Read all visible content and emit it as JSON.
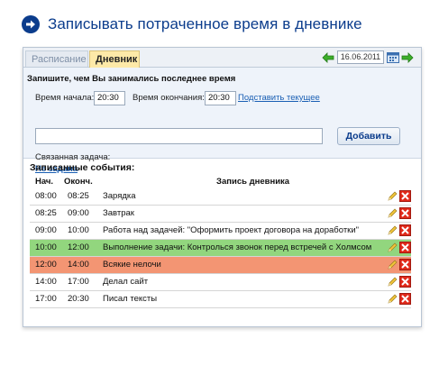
{
  "header": {
    "title": "Записывать потраченное время в дневнике",
    "icon": "arrow-right-icon"
  },
  "tabs": {
    "schedule": "Расписание",
    "diary": "Дневник"
  },
  "date_nav": {
    "date": "16.06.2011",
    "prev_icon": "arrow-left-icon",
    "next_icon": "arrow-right-icon",
    "calendar_icon": "calendar-icon"
  },
  "form": {
    "prompt": "Запишите, чем Вы занимались последнее время",
    "start_label": "Время начала:",
    "start_value": "20:30",
    "end_label": "Время окончания:",
    "end_value": "20:30",
    "now_link": "Подставить текущее",
    "entry_value": "",
    "add_button": "Добавить",
    "related_label": "Связанная задача:",
    "related_link": "Не задана"
  },
  "events": {
    "title": "Записанные события:",
    "columns": {
      "start": "Нач.",
      "end": "Оконч.",
      "entry": "Запись дневника"
    },
    "rows": [
      {
        "start": "08:00",
        "end": "08:25",
        "text": "Зарядка",
        "color": "#ffffff"
      },
      {
        "start": "08:25",
        "end": "09:00",
        "text": "Завтрак",
        "color": "#ffffff"
      },
      {
        "start": "09:00",
        "end": "10:00",
        "text": "Работа над задачей: \"Оформить проект договора на доработки\"",
        "color": "#ffffff"
      },
      {
        "start": "10:00",
        "end": "12:00",
        "text": "Выполнение задачи: Контролься звонок перед встречей с Холмсом",
        "color": "#92d67e"
      },
      {
        "start": "12:00",
        "end": "14:00",
        "text": "Всякие нелочи",
        "color": "#f39573"
      },
      {
        "start": "14:00",
        "end": "17:00",
        "text": "Делал сайт",
        "color": "#ffffff"
      },
      {
        "start": "17:00",
        "end": "20:30",
        "text": "Писал тексты",
        "color": "#ffffff"
      }
    ],
    "row_actions": {
      "edit_icon": "pencil-icon",
      "delete_icon": "delete-icon"
    }
  },
  "colors": {
    "accent": "#0b3c8c",
    "link": "#1a5fb4",
    "active_tab": "#fde9a8",
    "nav_green": "#3cae2a",
    "delete": "#e02a1b"
  }
}
